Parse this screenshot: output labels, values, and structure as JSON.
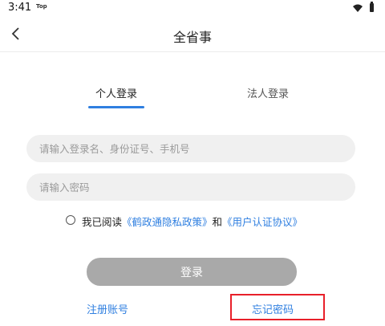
{
  "status_bar": {
    "time": "3:41",
    "top_label": "Top"
  },
  "header": {
    "title": "全省事"
  },
  "tabs": [
    {
      "label": "个人登录",
      "active": true
    },
    {
      "label": "法人登录",
      "active": false
    }
  ],
  "form": {
    "account_placeholder": "请输入登录名、身份证号、手机号",
    "password_placeholder": "请输入密码"
  },
  "agreement": {
    "prefix": "我已阅读",
    "privacy_link": "《鹤政通隐私政策》",
    "and": "和",
    "user_link": "《用户认证协议》"
  },
  "actions": {
    "login_label": "登录",
    "register_label": "注册账号",
    "forgot_label": "忘记密码"
  },
  "colors": {
    "accent": "#2f7fe0",
    "login_disabled": "#a9a9a9",
    "highlight": "#e8202a"
  },
  "icons": {
    "back": "chevron-left-icon",
    "wifi": "wifi-icon",
    "battery": "battery-icon"
  }
}
